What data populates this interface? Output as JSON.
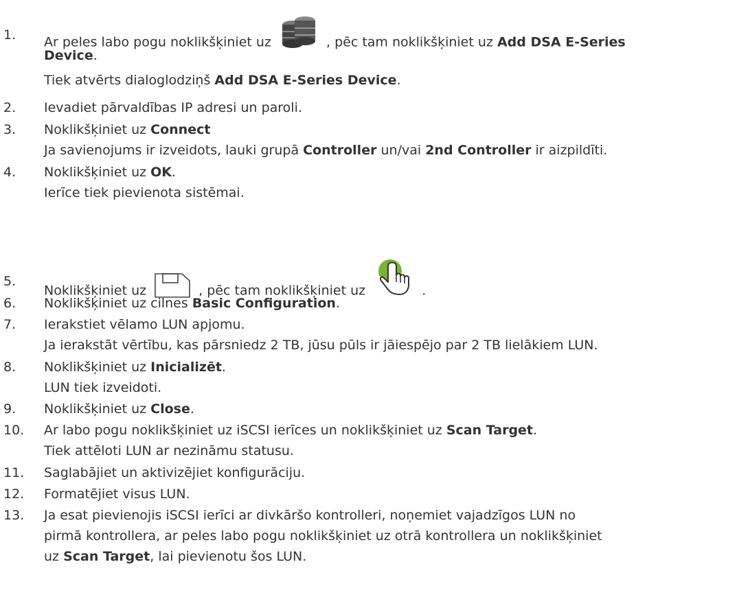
{
  "steps": [
    {
      "num": "1.",
      "line1": {
        "pre": "Ar peles labo pogu noklikšķiniet uz",
        "mid": ", pēc tam noklikšķiniet uz",
        "bold": "Add DSA E-Series"
      },
      "line2": {
        "bold": "Device",
        "post": "."
      },
      "line3": {
        "pre": "Tiek atvērts dialoglodziņš",
        "bold": "Add DSA E-Series Device",
        "post": "."
      },
      "icon": "storage-database-icon"
    },
    {
      "num": "2.",
      "text": "Ievadiet pārvaldības IP adresi un paroli."
    },
    {
      "num": "3.",
      "line1": {
        "pre": "Noklikšķiniet uz",
        "bold": "Connect"
      },
      "line2": {
        "pre": "Ja savienojums ir izveidots, lauki grupā",
        "bold1": "Controller",
        "mid": "un/vai",
        "bold2": "2nd Controller",
        "post": "ir aizpildīti."
      }
    },
    {
      "num": "4.",
      "line1": {
        "pre": "Noklikšķiniet uz",
        "bold": "OK",
        "post": "."
      },
      "line2": {
        "text": "Ierīce tiek pievienota sistēmai."
      }
    },
    {
      "num": "5.",
      "pre": "Noklikšķiniet uz",
      "mid": ", pēc tam noklikšķiniet uz",
      "post": ".",
      "icon1": "save-icon",
      "icon2": "green-hand-click-icon"
    },
    {
      "num": "6.",
      "pre": "Noklikšķiniet uz cilnes",
      "bold": "Basic Configuration",
      "post": "."
    },
    {
      "num": "7.",
      "line1": "Ierakstiet vēlamo LUN apjomu.",
      "line2": "Ja ierakstāt vērtību, kas pārsniedz 2 TB, jūsu pūls ir jāiespējo par 2 TB lielākiem LUN."
    },
    {
      "num": "8.",
      "line1": {
        "pre": "Noklikšķiniet uz",
        "bold": "Inicializēt",
        "post": "."
      },
      "line2": "LUN tiek izveidoti."
    },
    {
      "num": "9.",
      "pre": "Noklikšķiniet uz",
      "bold": "Close",
      "post": "."
    },
    {
      "num": "10.",
      "line1": {
        "pre": "Ar labo pogu noklikšķiniet uz iSCSI ierīces un noklikšķiniet uz",
        "bold": "Scan Target",
        "post": "."
      },
      "line2": "Tiek attēloti LUN ar nezināmu statusu."
    },
    {
      "num": "11.",
      "text": "Saglabājiet un aktivizējiet konfigurāciju."
    },
    {
      "num": "12.",
      "text": "Formatējiet visus LUN."
    },
    {
      "num": "13.",
      "line1": "Ja esat pievienojis iSCSI ierīci ar divkāršo kontrolleri, noņemiet vajadzīgos LUN no",
      "line2": "pirmā kontrollera, ar peles labo pogu noklikšķiniet uz otrā kontrollera un noklikšķiniet",
      "line3": {
        "pre": "uz",
        "bold": "Scan Target",
        "post": ", lai pievienotu šos LUN."
      }
    }
  ],
  "colors": {
    "text": "#333333",
    "hand_green": "#7ab32e",
    "icon_gray": "#555555"
  }
}
